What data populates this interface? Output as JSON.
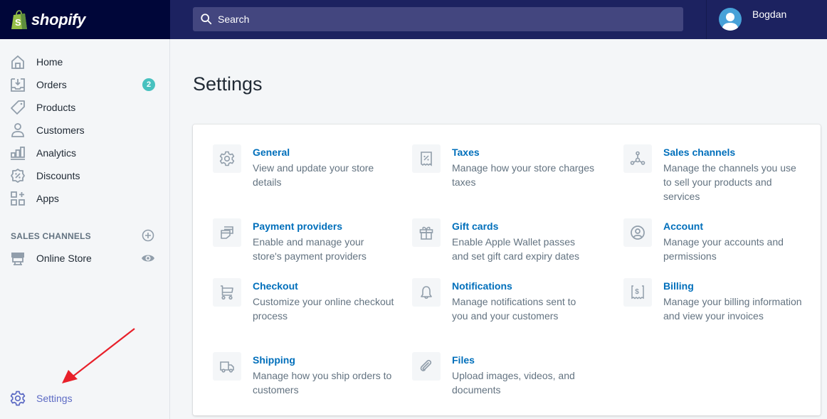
{
  "brand": {
    "name": "shopify",
    "icon": "shopping-bag-icon",
    "color": "#95bf47"
  },
  "header": {
    "search_placeholder": "Search",
    "user_name": "Bogdan"
  },
  "sidebar": {
    "items": [
      {
        "label": "Home",
        "icon": "home-icon"
      },
      {
        "label": "Orders",
        "icon": "orders-icon",
        "badge": "2"
      },
      {
        "label": "Products",
        "icon": "tag-icon"
      },
      {
        "label": "Customers",
        "icon": "person-icon"
      },
      {
        "label": "Analytics",
        "icon": "bar-chart-icon"
      },
      {
        "label": "Discounts",
        "icon": "discount-icon"
      },
      {
        "label": "Apps",
        "icon": "apps-icon"
      }
    ],
    "sales_channels_heading": "SALES CHANNELS",
    "channels": [
      {
        "label": "Online Store",
        "icon": "store-icon"
      }
    ],
    "settings_label": "Settings"
  },
  "main": {
    "title": "Settings",
    "tiles": [
      {
        "title": "General",
        "desc": "View and update your store details",
        "icon": "gear-icon"
      },
      {
        "title": "Taxes",
        "desc": "Manage how your store charges taxes",
        "icon": "tax-receipt-icon"
      },
      {
        "title": "Sales channels",
        "desc": "Manage the channels you use to sell your products and services",
        "icon": "channels-icon"
      },
      {
        "title": "Payment providers",
        "desc": "Enable and manage your store's payment providers",
        "icon": "payment-icon"
      },
      {
        "title": "Gift cards",
        "desc": "Enable Apple Wallet passes and set gift card expiry dates",
        "icon": "gift-icon"
      },
      {
        "title": "Account",
        "desc": "Manage your accounts and permissions",
        "icon": "account-icon"
      },
      {
        "title": "Checkout",
        "desc": "Customize your online checkout process",
        "icon": "cart-icon"
      },
      {
        "title": "Notifications",
        "desc": "Manage notifications sent to you and your customers",
        "icon": "bell-icon"
      },
      {
        "title": "Billing",
        "desc": "Manage your billing information and view your invoices",
        "icon": "billing-icon"
      },
      {
        "title": "Shipping",
        "desc": "Manage how you ship orders to customers",
        "icon": "truck-icon"
      },
      {
        "title": "Files",
        "desc": "Upload images, videos, and documents",
        "icon": "paperclip-icon"
      }
    ]
  },
  "colors": {
    "topbar": "#1c2260",
    "brand_bg": "#000639",
    "link": "#006fbb",
    "badge": "#47c1bf",
    "active": "#5c6ac4",
    "annotation_arrow": "#e8202a"
  }
}
